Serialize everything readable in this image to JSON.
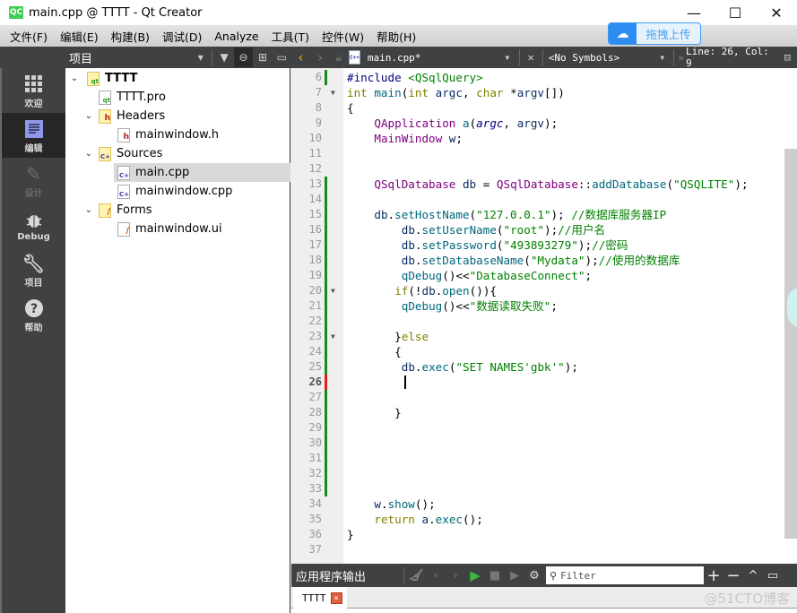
{
  "window": {
    "title": "main.cpp @ TTTT - Qt Creator",
    "logo": "QC",
    "minimize": "—",
    "maximize": "☐",
    "close": "✕"
  },
  "menu": [
    "文件(F)",
    "编辑(E)",
    "构建(B)",
    "调试(D)",
    "Analyze",
    "工具(T)",
    "控件(W)",
    "帮助(H)"
  ],
  "upload_widget": {
    "label": "拖拽上传",
    "icon": "cloud-icon"
  },
  "project_toolbar": {
    "selector": "项目"
  },
  "editor_toolbar": {
    "file": "main.cpp*",
    "symbols": "<No Symbols>",
    "position": "Line: 26, Col: 9"
  },
  "modes": [
    {
      "label": "欢迎",
      "icon": "grid-icon"
    },
    {
      "label": "编辑",
      "icon": "edit-doc-icon",
      "active": true
    },
    {
      "label": "设计",
      "icon": "pencil-icon",
      "disabled": true
    },
    {
      "label": "Debug",
      "icon": "bug-icon"
    },
    {
      "label": "项目",
      "icon": "wrench-icon"
    },
    {
      "label": "帮助",
      "icon": "help-icon"
    }
  ],
  "tree": [
    {
      "label": "TTTT",
      "level": 0,
      "expanded": true,
      "icon": "qt-project-folder",
      "bold": true
    },
    {
      "label": "TTTT.pro",
      "level": 1,
      "icon": "qt-pro-file"
    },
    {
      "label": "Headers",
      "level": 1,
      "expanded": true,
      "icon": "header-folder"
    },
    {
      "label": "mainwindow.h",
      "level": 2,
      "icon": "header-file"
    },
    {
      "label": "Sources",
      "level": 1,
      "expanded": true,
      "icon": "source-folder"
    },
    {
      "label": "main.cpp",
      "level": 2,
      "icon": "cpp-file",
      "selected": true
    },
    {
      "label": "mainwindow.cpp",
      "level": 2,
      "icon": "cpp-file"
    },
    {
      "label": "Forms",
      "level": 1,
      "expanded": true,
      "icon": "forms-folder"
    },
    {
      "label": "mainwindow.ui",
      "level": 2,
      "icon": "ui-file"
    }
  ],
  "code": {
    "current_line": 26,
    "lines": [
      {
        "n": 6,
        "text": "#include <QSqlQuery>"
      },
      {
        "n": 7,
        "text": "int main(int argc, char *argv[])",
        "fold": true
      },
      {
        "n": 8,
        "text": "{"
      },
      {
        "n": 9,
        "text": "    QApplication a(argc, argv);"
      },
      {
        "n": 10,
        "text": "    MainWindow w;"
      },
      {
        "n": 11,
        "text": ""
      },
      {
        "n": 12,
        "text": ""
      },
      {
        "n": 13,
        "text": "    QSqlDatabase db = QSqlDatabase::addDatabase(\"QSQLITE\");"
      },
      {
        "n": 14,
        "text": ""
      },
      {
        "n": 15,
        "text": "    db.setHostName(\"127.0.0.1\"); //数据库服务器IP"
      },
      {
        "n": 16,
        "text": "        db.setUserName(\"root\");//用户名"
      },
      {
        "n": 17,
        "text": "        db.setPassword(\"493893279\");//密码"
      },
      {
        "n": 18,
        "text": "        db.setDatabaseName(\"Mydata\");//使用的数据库"
      },
      {
        "n": 19,
        "text": "        qDebug()<<\"DatabaseConnect\";"
      },
      {
        "n": 20,
        "text": "       if(!db.open()){",
        "fold": true
      },
      {
        "n": 21,
        "text": "        qDebug()<<\"数据读取失败\";"
      },
      {
        "n": 22,
        "text": ""
      },
      {
        "n": 23,
        "text": "       }else",
        "fold": true
      },
      {
        "n": 24,
        "text": "       {"
      },
      {
        "n": 25,
        "text": "        db.exec(\"SET NAMES'gbk'\");"
      },
      {
        "n": 26,
        "text": ""
      },
      {
        "n": 27,
        "text": ""
      },
      {
        "n": 28,
        "text": "       }"
      },
      {
        "n": 29,
        "text": ""
      },
      {
        "n": 30,
        "text": ""
      },
      {
        "n": 31,
        "text": ""
      },
      {
        "n": 32,
        "text": ""
      },
      {
        "n": 33,
        "text": ""
      },
      {
        "n": 34,
        "text": "    w.show();"
      },
      {
        "n": 35,
        "text": "    return a.exec();"
      },
      {
        "n": 36,
        "text": "}"
      },
      {
        "n": 37,
        "text": ""
      }
    ]
  },
  "output": {
    "title": "应用程序输出",
    "filter_placeholder": "Filter",
    "tab": "TTTT",
    "watermark": "@51CTO博客"
  }
}
